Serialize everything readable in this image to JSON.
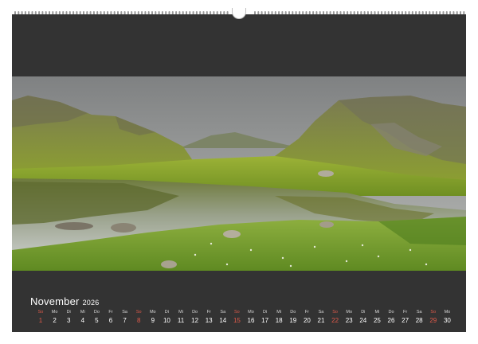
{
  "calendar": {
    "month": "November",
    "year": "2026",
    "days": [
      {
        "dow": "So",
        "num": "1",
        "sunday": true
      },
      {
        "dow": "Mo",
        "num": "2"
      },
      {
        "dow": "Di",
        "num": "3"
      },
      {
        "dow": "Mi",
        "num": "4"
      },
      {
        "dow": "Do",
        "num": "5"
      },
      {
        "dow": "Fr",
        "num": "6"
      },
      {
        "dow": "Sa",
        "num": "7"
      },
      {
        "dow": "So",
        "num": "8",
        "sunday": true
      },
      {
        "dow": "Mo",
        "num": "9"
      },
      {
        "dow": "Di",
        "num": "10"
      },
      {
        "dow": "Mi",
        "num": "11"
      },
      {
        "dow": "Do",
        "num": "12"
      },
      {
        "dow": "Fr",
        "num": "13"
      },
      {
        "dow": "Sa",
        "num": "14"
      },
      {
        "dow": "So",
        "num": "15",
        "sunday": true
      },
      {
        "dow": "Mo",
        "num": "16"
      },
      {
        "dow": "Di",
        "num": "17"
      },
      {
        "dow": "Mi",
        "num": "18"
      },
      {
        "dow": "Do",
        "num": "19"
      },
      {
        "dow": "Fr",
        "num": "20"
      },
      {
        "dow": "Sa",
        "num": "21"
      },
      {
        "dow": "So",
        "num": "22",
        "sunday": true
      },
      {
        "dow": "Mo",
        "num": "23"
      },
      {
        "dow": "Di",
        "num": "24"
      },
      {
        "dow": "Mi",
        "num": "25"
      },
      {
        "dow": "Do",
        "num": "26"
      },
      {
        "dow": "Fr",
        "num": "27"
      },
      {
        "dow": "Sa",
        "num": "28"
      },
      {
        "dow": "So",
        "num": "29",
        "sunday": true
      },
      {
        "dow": "Mo",
        "num": "30"
      }
    ]
  },
  "colors": {
    "sheet": "#333333",
    "sunday": "#e05a4a",
    "text": "#ffffff"
  }
}
